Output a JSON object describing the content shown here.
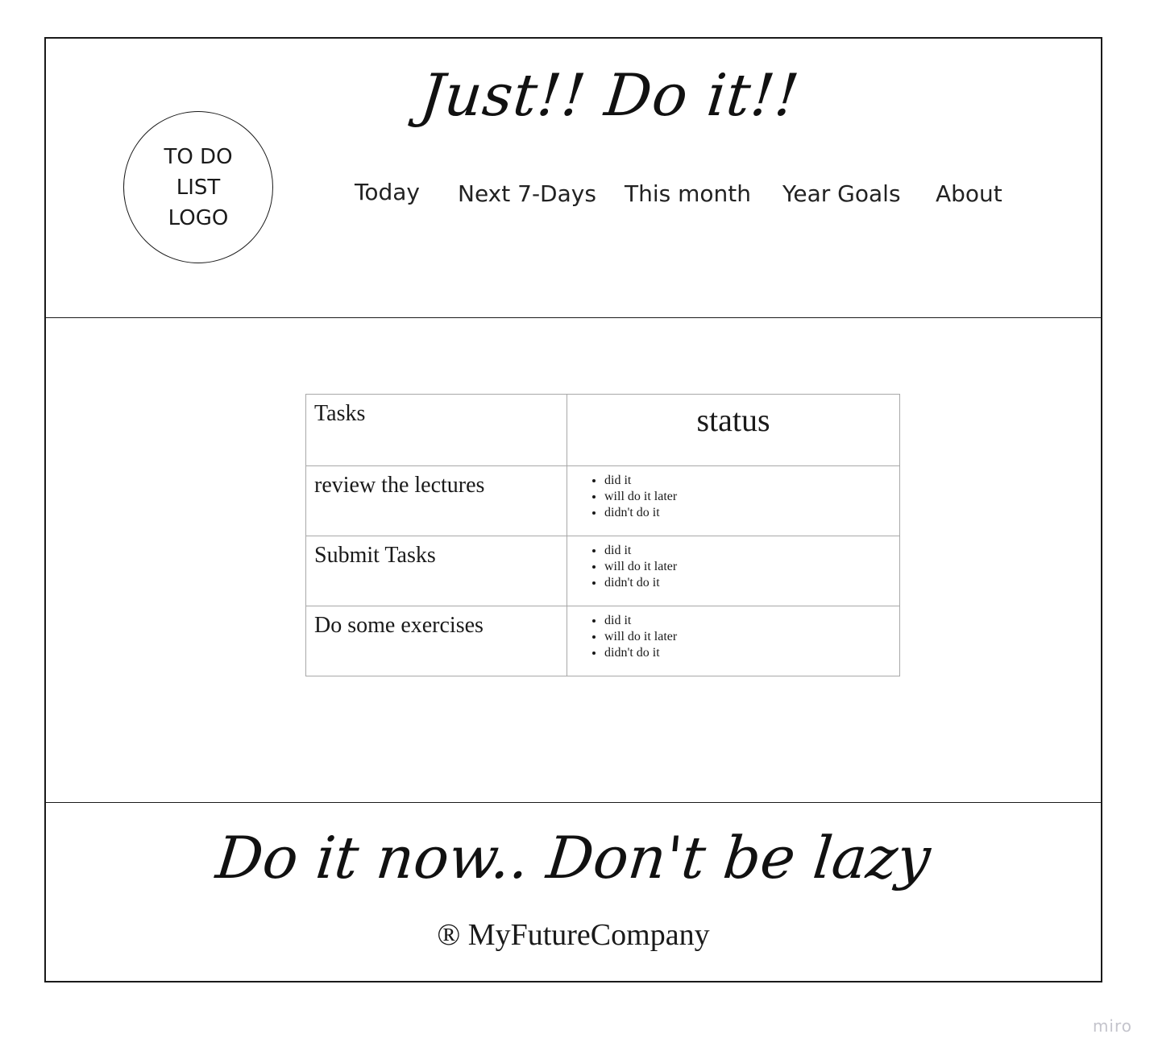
{
  "header": {
    "logo_lines": [
      "TO DO",
      "LIST",
      "LOGO"
    ],
    "title": "Just!! Do it!!",
    "nav": [
      "Today",
      "Next 7-Days",
      "This month",
      "Year Goals",
      "About"
    ]
  },
  "table": {
    "headers": {
      "tasks": "Tasks",
      "status": "status"
    },
    "status_options": [
      "did it",
      "will do it later",
      "didn't do it"
    ],
    "rows": [
      {
        "task": "review the lectures"
      },
      {
        "task": "Submit Tasks"
      },
      {
        "task": "Do some exercises"
      }
    ]
  },
  "footer": {
    "slogan": "Do it now.. Don't be lazy",
    "copyright": "® MyFutureCompany"
  },
  "watermark": "miro"
}
